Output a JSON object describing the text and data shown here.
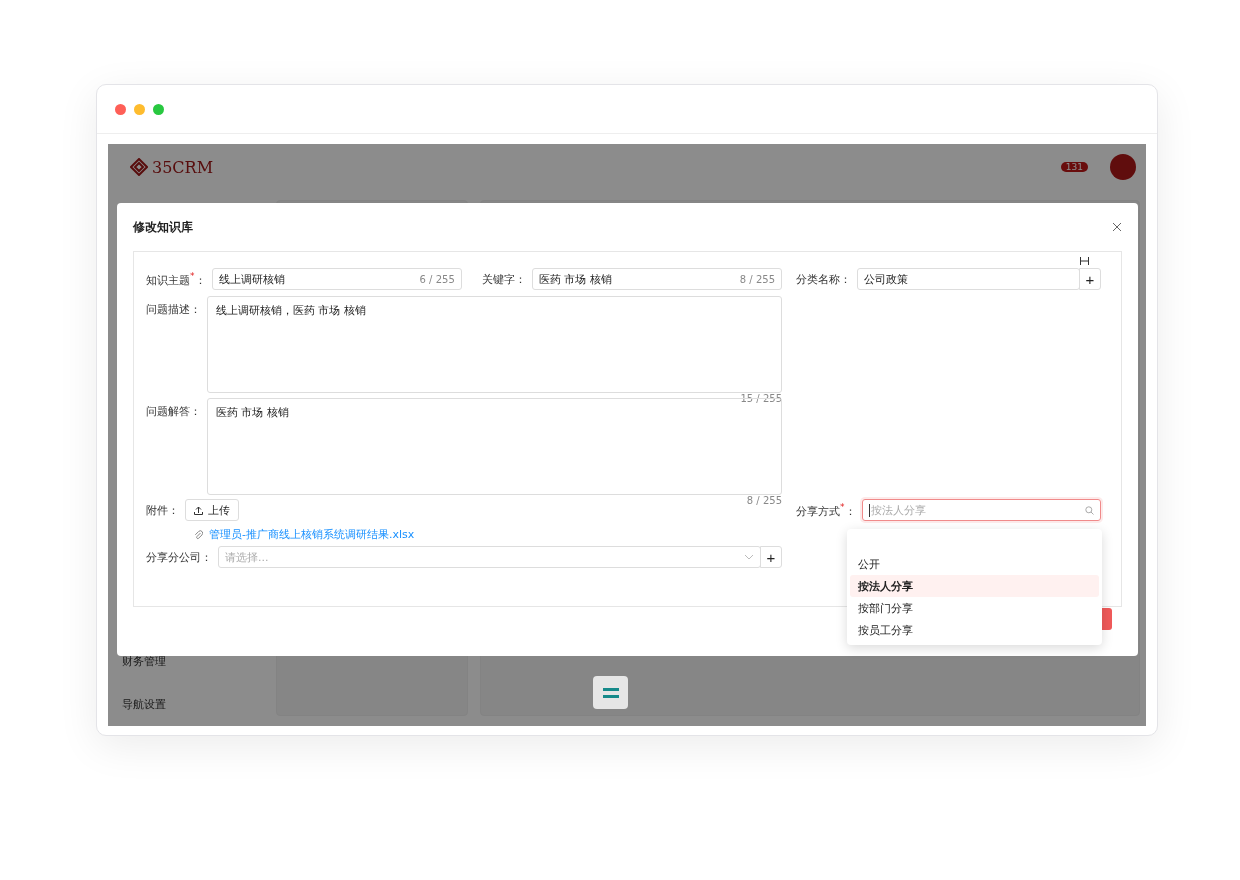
{
  "app": {
    "logo": "35CRM",
    "notification_badge": "131",
    "sidebar": {
      "items": [
        {
          "label": "财务管理"
        }
      ],
      "footer": "导航设置"
    }
  },
  "dialog": {
    "title": "修改知识库",
    "topic": {
      "label": "知识主题$^{*}$：",
      "value": "线上调研核销",
      "counter": "6 / 255"
    },
    "keywords": {
      "label": "关键字：",
      "value": "医药 市场 核销",
      "counter": "8 / 255"
    },
    "category": {
      "label": "分类名称：",
      "value": "公司政策",
      "add_button": "+"
    },
    "description": {
      "label": "问题描述：",
      "value": "线上调研核销，医药 市场 核销",
      "counter": "15 / 255"
    },
    "answer": {
      "label": "问题解答：",
      "value": "医药 市场 核销",
      "counter": "8 / 255"
    },
    "attachment": {
      "label": "附件：",
      "upload_button": "上传",
      "files": [
        "管理员-推广商线上核销系统调研结果.xlsx"
      ]
    },
    "share_company": {
      "label": "分享分公司：",
      "placeholder": "请选择...",
      "add_button": "+"
    },
    "share_method": {
      "label": "分享方式$^{*}$：",
      "placeholder": "按法人分享",
      "focused": true,
      "options": [
        {
          "label": "公开",
          "selected": false
        },
        {
          "label": "按法人分享",
          "selected": true
        },
        {
          "label": "按部门分享",
          "selected": false
        },
        {
          "label": "按员工分享",
          "selected": false
        }
      ]
    }
  }
}
